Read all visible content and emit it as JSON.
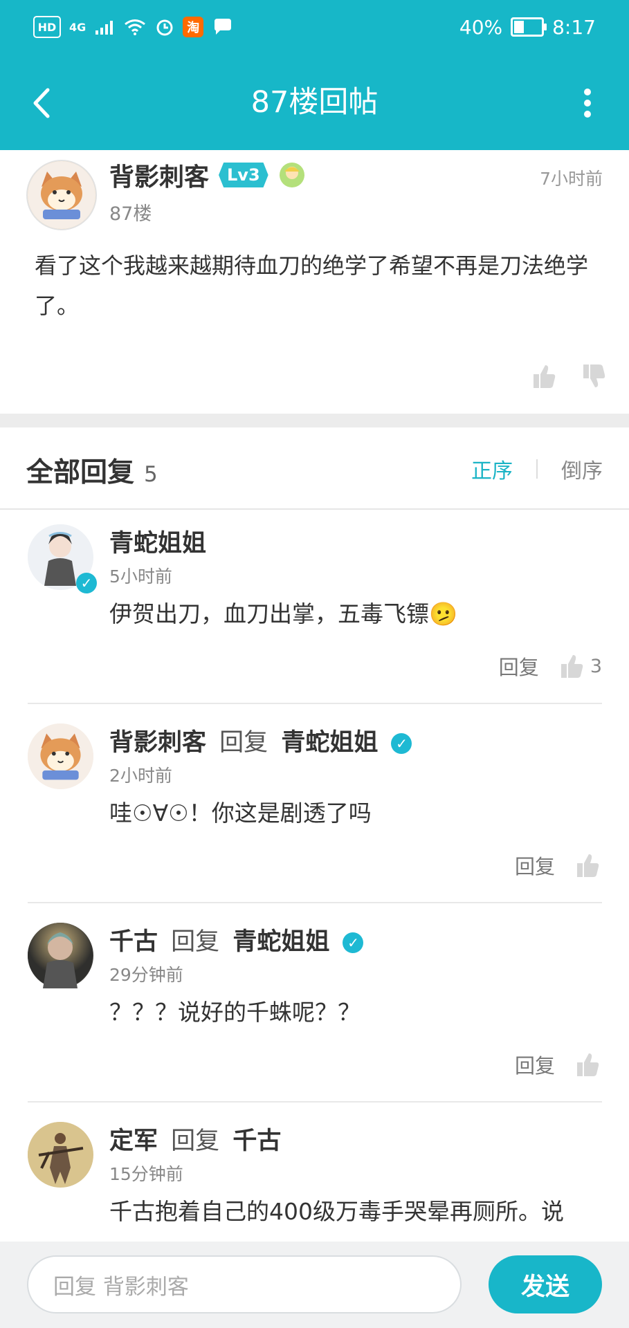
{
  "status_bar": {
    "left_icons": [
      "hd",
      "4g",
      "signal",
      "wifi",
      "alarm",
      "taobao",
      "message"
    ],
    "battery_percent": "40%",
    "time": "8:17"
  },
  "nav": {
    "title": "87楼回帖"
  },
  "post": {
    "author": "背影刺客",
    "level": "Lv3",
    "floor": "87楼",
    "time": "7小时前",
    "content": "看了这个我越来越期待血刀的绝学了希望不再是刀法绝学了。"
  },
  "comments_header": {
    "title": "全部回复",
    "count": "5",
    "sort_asc": "正序",
    "sort_desc": "倒序"
  },
  "replies": [
    {
      "author": "青蛇姐姐",
      "reply_to_label": "",
      "reply_to": "",
      "time": "5小时前",
      "content": "伊贺出刀，血刀出掌，五毒飞镖🫤",
      "action_reply": "回复",
      "likes": "3"
    },
    {
      "author": "背影刺客",
      "reply_to_label": "回复",
      "reply_to": "青蛇姐姐",
      "time": "2小时前",
      "content": "哇☉∀☉！你这是剧透了吗",
      "action_reply": "回复",
      "likes": ""
    },
    {
      "author": "千古",
      "reply_to_label": "回复",
      "reply_to": "青蛇姐姐",
      "time": "29分钟前",
      "content": "？？？说好的千蛛呢？？",
      "action_reply": "回复",
      "likes": ""
    },
    {
      "author": "定军",
      "reply_to_label": "回复",
      "reply_to": "千古",
      "time": "15分钟前",
      "content": "千古抱着自己的400级万毒手哭晕再厕所。说",
      "action_reply": "",
      "likes": ""
    }
  ],
  "bottom_bar": {
    "placeholder": "回复 背影刺客",
    "send": "发送"
  },
  "colors": {
    "accent": "#17b7c8",
    "verified": "#1eb9d3"
  }
}
